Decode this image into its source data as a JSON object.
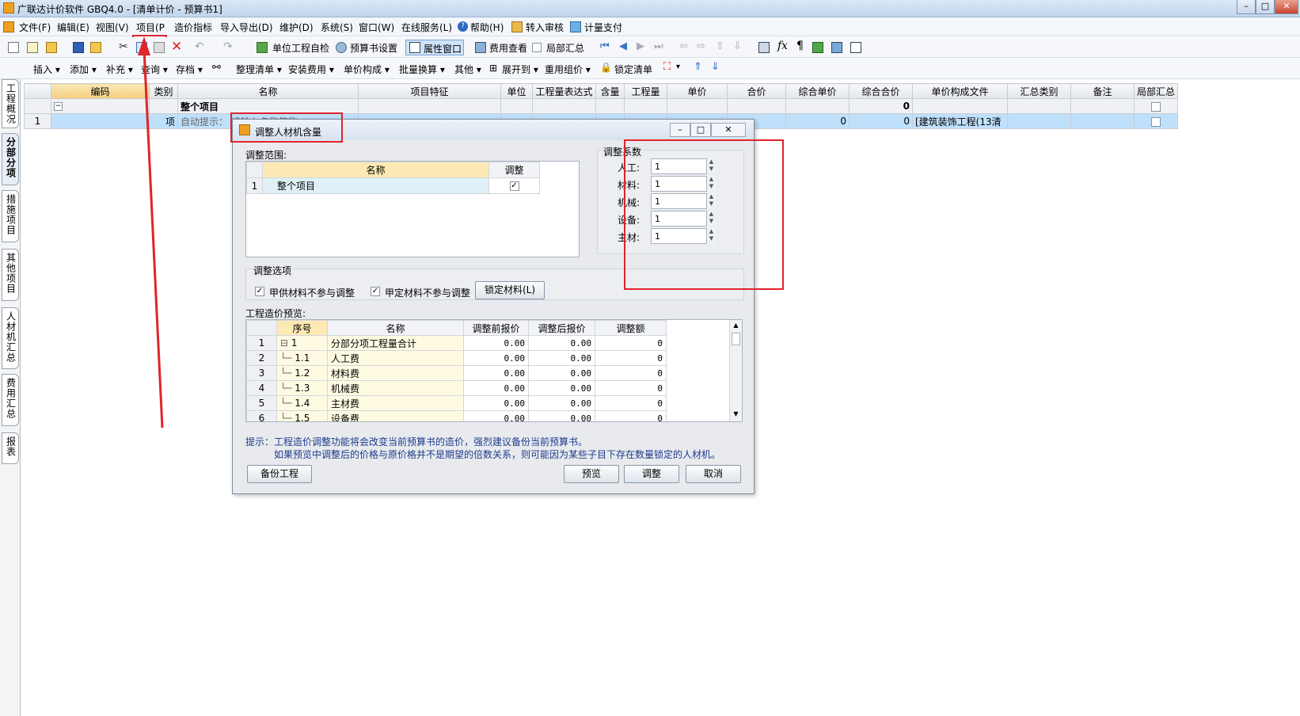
{
  "window": {
    "title": "广联达计价软件 GBQ4.0 - [清单计价 - 预算书1]"
  },
  "menu": [
    "文件(F)",
    "编辑(E)",
    "视图(V)",
    "项目(P",
    "造价指标",
    "导入导出(D)",
    "维护(D)",
    "系统(S)",
    "窗口(W)",
    "在线服务(L)",
    "帮助(H)",
    "转入审核",
    "计量支付"
  ],
  "toolbar1": {
    "unit_check": "单位工程自检",
    "budget_settings": "预算书设置",
    "property_window": "属性窗口",
    "fee_view": "费用查看",
    "partial_summary": "局部汇总"
  },
  "toolbar2": [
    "插入",
    "添加",
    "补充",
    "查询",
    "存档",
    "整理清单",
    "安装费用",
    "单价构成",
    "批量换算",
    "其他",
    "展开到",
    "重用组价",
    "锁定清单"
  ],
  "sidetabs": [
    "工程概况",
    "分部分项",
    "措施项目",
    "其他项目",
    "人材机汇总",
    "费用汇总",
    "报表"
  ],
  "grid": {
    "headers": [
      "编码",
      "类别",
      "名称",
      "项目特征",
      "单位",
      "工程量表达式",
      "含量",
      "工程量",
      "单价",
      "合价",
      "综合单价",
      "综合合价",
      "单价构成文件",
      "汇总类别",
      "备注",
      "局部汇总"
    ],
    "row0": {
      "name": "整个项目",
      "total": "0"
    },
    "row1": {
      "num": "1",
      "type": "项",
      "hint": "自动提示：",
      "hint_tail": "请输入名称简称",
      "unit_price": "0",
      "total_price": "0",
      "template": "[建筑装饰工程(13清"
    }
  },
  "dialog": {
    "title": "调整人材机含量",
    "scope_label": "调整范围:",
    "scope_headers": [
      "名称",
      "调整"
    ],
    "scope_rows": [
      {
        "num": "1",
        "name": "整个项目"
      }
    ],
    "coef_label": "调整系数",
    "coefficients": [
      {
        "label": "人工:",
        "value": "1"
      },
      {
        "label": "材料:",
        "value": "1"
      },
      {
        "label": "机械:",
        "value": "1"
      },
      {
        "label": "设备:",
        "value": "1"
      },
      {
        "label": "主材:",
        "value": "1"
      }
    ],
    "options_label": "调整选项",
    "opt1": "甲供材料不参与调整",
    "opt2": "甲定材料不参与调整",
    "lock_button": "锁定材料(L)",
    "preview_label": "工程造价预览:",
    "preview_headers": [
      "序号",
      "名称",
      "调整前报价",
      "调整后报价",
      "调整额"
    ],
    "preview_rows": [
      {
        "row": "1",
        "seq": "1",
        "name": "分部分项工程量合计",
        "before": "0.00",
        "after": "0.00",
        "diff": "0"
      },
      {
        "row": "2",
        "seq": "1.1",
        "name": "人工费",
        "before": "0.00",
        "after": "0.00",
        "diff": "0"
      },
      {
        "row": "3",
        "seq": "1.2",
        "name": "材料费",
        "before": "0.00",
        "after": "0.00",
        "diff": "0"
      },
      {
        "row": "4",
        "seq": "1.3",
        "name": "机械费",
        "before": "0.00",
        "after": "0.00",
        "diff": "0"
      },
      {
        "row": "5",
        "seq": "1.4",
        "name": "主材费",
        "before": "0.00",
        "after": "0.00",
        "diff": "0"
      },
      {
        "row": "6",
        "seq": "1.5",
        "name": "设备费",
        "before": "0.00",
        "after": "0.00",
        "diff": "0"
      }
    ],
    "hint1": "提示：工程造价调整功能将会改变当前预算书的造价，强烈建议备份当前预算书。",
    "hint2": "如果预览中调整后的价格与原价格并不是期望的倍数关系，则可能因为某些子目下存在数量锁定的人材机。",
    "backup_button": "备份工程",
    "preview_button": "预览",
    "adjust_button": "调整",
    "cancel_button": "取消"
  },
  "annotation_color": "#e0242a"
}
